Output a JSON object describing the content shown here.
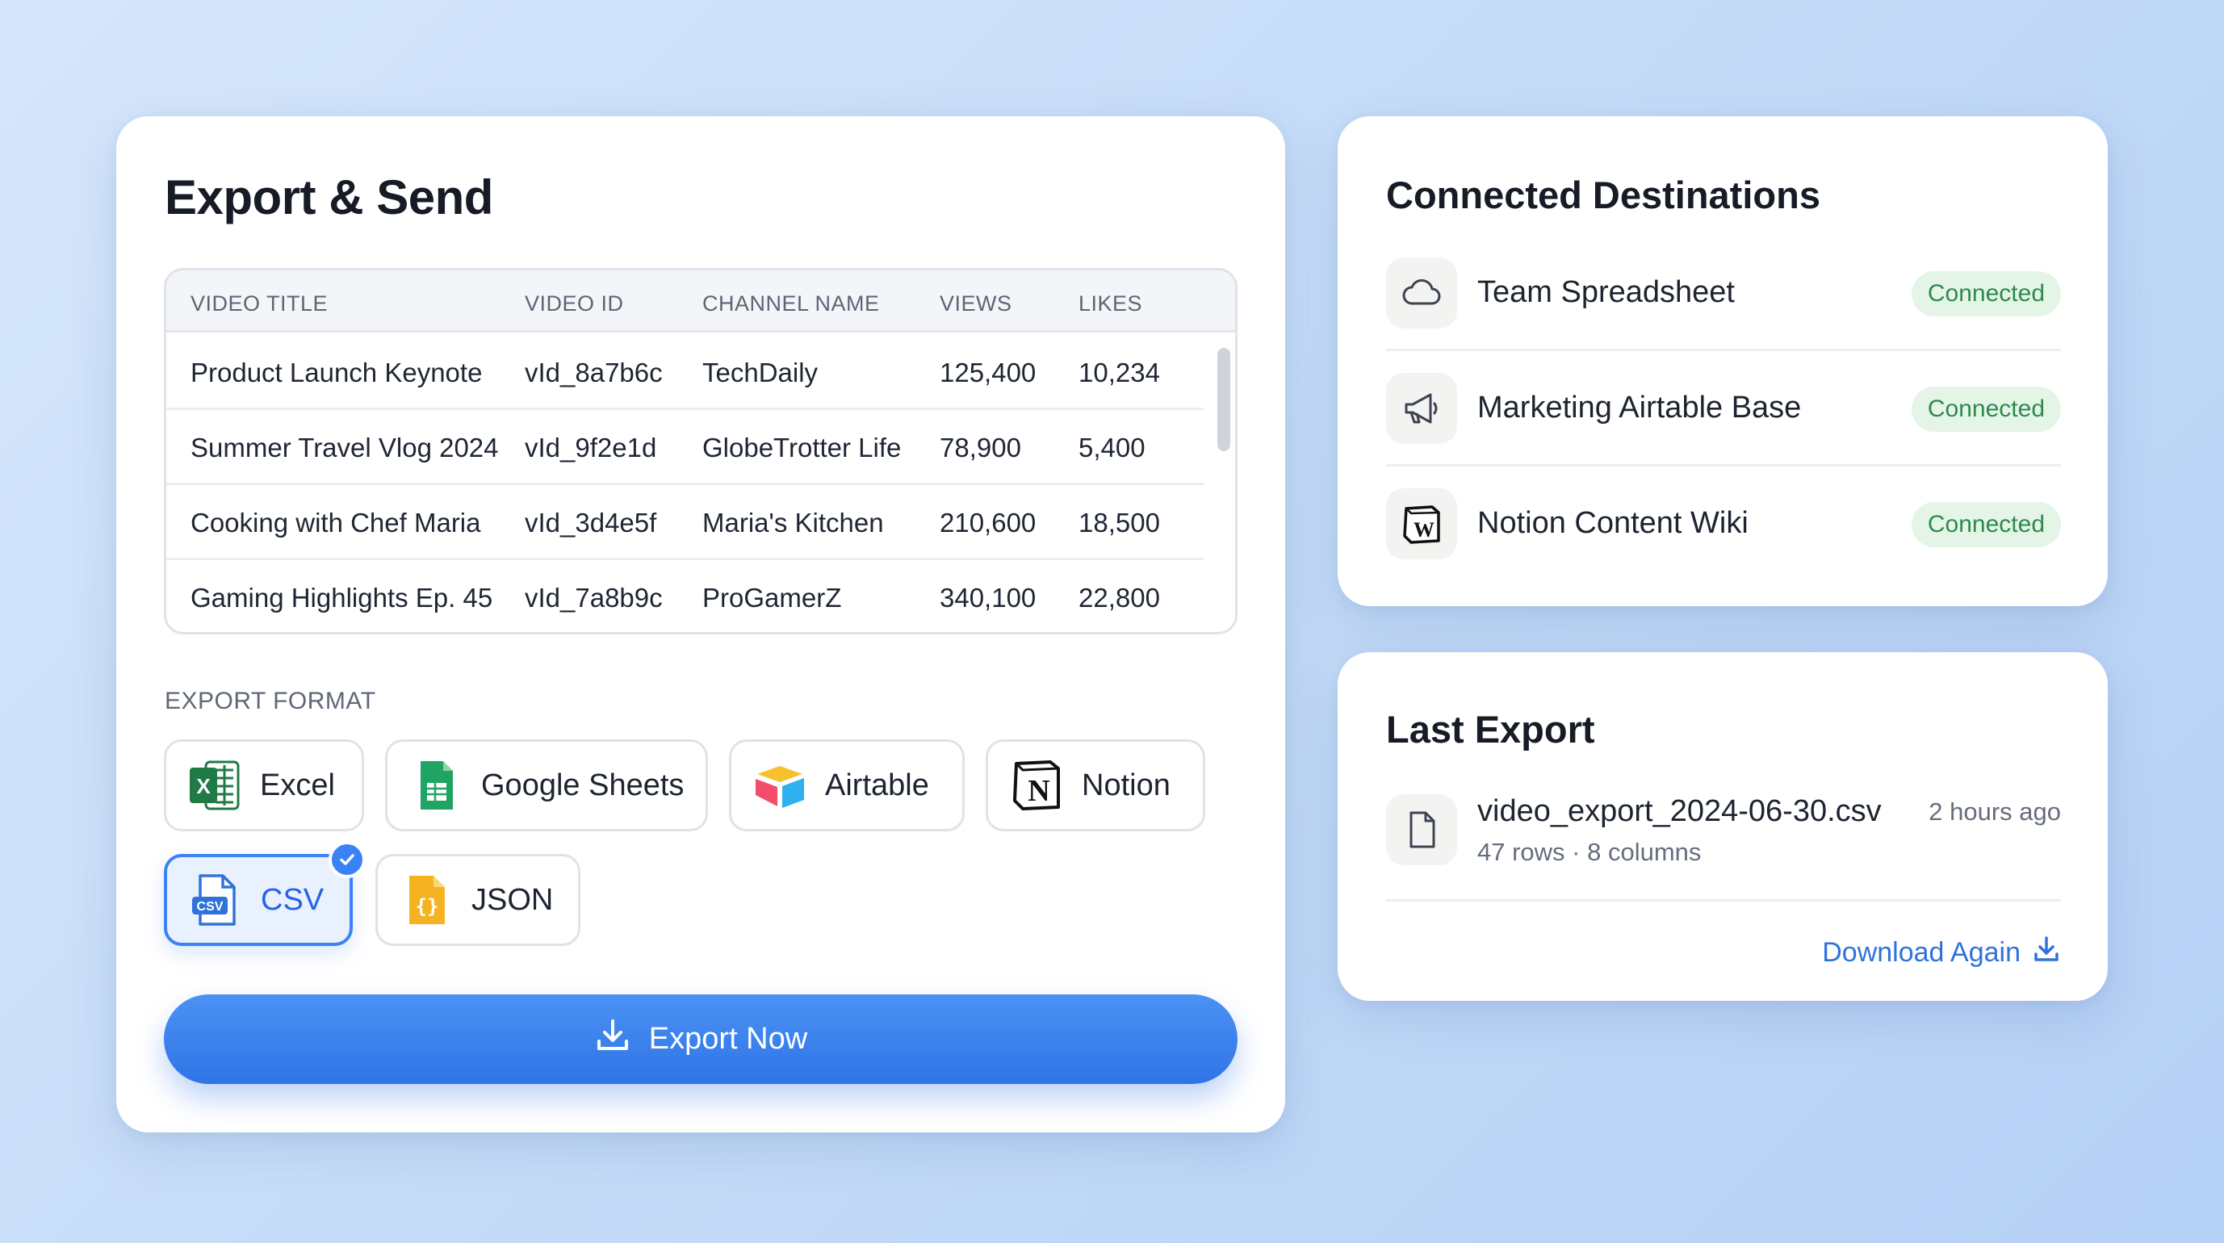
{
  "export_card": {
    "title": "Export & Send",
    "table": {
      "columns": [
        "VIDEO TITLE",
        "VIDEO ID",
        "CHANNEL NAME",
        "VIEWS",
        "LIKES"
      ],
      "rows": [
        [
          "Product Launch Keynote",
          "vId_8a7b6c",
          "TechDaily",
          "125,400",
          "10,234"
        ],
        [
          "Summer Travel Vlog 2024",
          "vId_9f2e1d",
          "GlobeTrotter Life",
          "78,900",
          "5,400"
        ],
        [
          "Cooking with Chef Maria",
          "vId_3d4e5f",
          "Maria's Kitchen",
          "210,600",
          "18,500"
        ],
        [
          "Gaming Highlights Ep. 45",
          "vId_7a8b9c",
          "ProGamerZ",
          "340,100",
          "22,800"
        ]
      ]
    },
    "format_label": "EXPORT FORMAT",
    "formats": [
      {
        "label": "Excel",
        "icon": "excel-icon",
        "selected": false
      },
      {
        "label": "Google Sheets",
        "icon": "google-sheets-icon",
        "selected": false
      },
      {
        "label": "Airtable",
        "icon": "airtable-icon",
        "selected": false
      },
      {
        "label": "Notion",
        "icon": "notion-icon",
        "selected": false
      },
      {
        "label": "CSV",
        "icon": "csv-file-icon",
        "selected": true
      },
      {
        "label": "JSON",
        "icon": "json-file-icon",
        "selected": false
      }
    ],
    "export_button": "Export Now"
  },
  "destinations": {
    "title": "Connected Destinations",
    "items": [
      {
        "name": "Team Spreadsheet",
        "icon": "cloud-icon",
        "status": "Connected"
      },
      {
        "name": "Marketing Airtable Base",
        "icon": "megaphone-icon",
        "status": "Connected"
      },
      {
        "name": "Notion Content Wiki",
        "icon": "wiki-icon",
        "status": "Connected"
      }
    ]
  },
  "last_export": {
    "title": "Last Export",
    "file_name": "video_export_2024-06-30.csv",
    "meta": "47 rows · 8 columns",
    "time": "2 hours ago",
    "download_label": "Download Again"
  },
  "colors": {
    "accent": "#3b82f6",
    "connected_bg": "#e4f5e8",
    "connected_text": "#2e8a4c",
    "excel": "#1f7a45",
    "google_sheets": "#1fa463",
    "json": "#f5b321"
  }
}
